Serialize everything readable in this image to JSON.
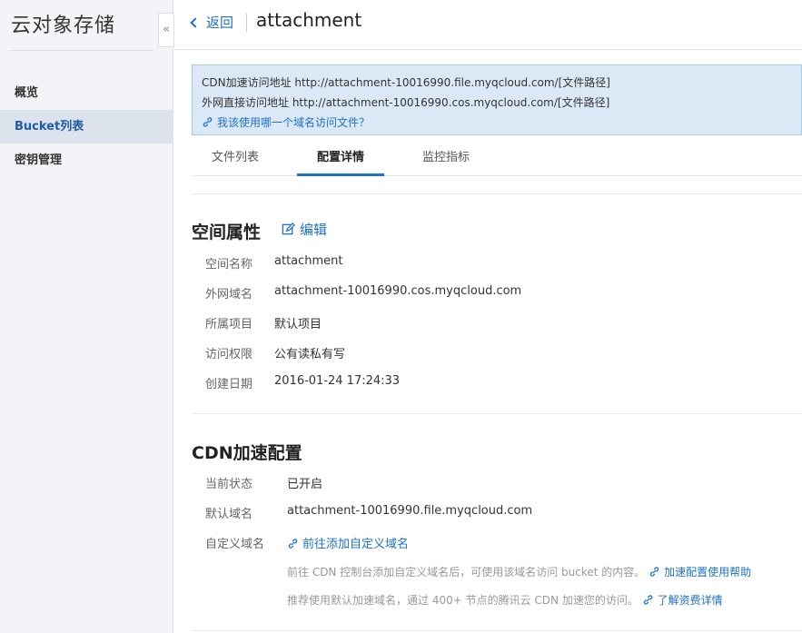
{
  "sidebar": {
    "title": "云对象存储",
    "collapse_icon": "«",
    "items": [
      {
        "label": "概览",
        "active": false
      },
      {
        "label": "Bucket列表",
        "active": true
      },
      {
        "label": "密钥管理",
        "active": false
      }
    ]
  },
  "header": {
    "back_label": "返回",
    "title": "attachment"
  },
  "notice": {
    "cdn_line": "CDN加速访问地址 http://attachment-10016990.file.myqcloud.com/[文件路径]",
    "direct_line": "外网直接访问地址 http://attachment-10016990.cos.myqcloud.com/[文件路径]",
    "help_link": "我该使用哪一个域名访问文件？"
  },
  "tabs": [
    {
      "label": "文件列表",
      "active": false
    },
    {
      "label": "配置详情",
      "active": true
    },
    {
      "label": "监控指标",
      "active": false
    }
  ],
  "space": {
    "title": "空间属性",
    "edit_label": "编辑",
    "rows": [
      {
        "label": "空间名称",
        "value": "attachment"
      },
      {
        "label": "外网域名",
        "value": "attachment-10016990.cos.myqcloud.com"
      },
      {
        "label": "所属项目",
        "value": "默认项目"
      },
      {
        "label": "访问权限",
        "value": "公有读私有写"
      },
      {
        "label": "创建日期",
        "value": "2016-01-24 17:24:33"
      }
    ]
  },
  "cdn": {
    "title": "CDN加速配置",
    "status_label": "当前状态",
    "status_value": "已开启",
    "domain_label": "默认域名",
    "domain_value": "attachment-10016990.file.myqcloud.com",
    "custom_label": "自定义域名",
    "custom_link": "前往添加自定义域名",
    "hint1_text": "前往 CDN 控制台添加自定义域名后，可使用该域名访问 bucket 的内容。",
    "hint1_link": "加速配置使用帮助",
    "hint2_text": "推荐使用默认加速域名，通过 400+ 节点的腾讯云 CDN 加速您的访问。",
    "hint2_link": "了解资费详情"
  },
  "colors": {
    "accent": "#1e71c5",
    "notice_bg": "#dbe9f7",
    "sidebar_bg": "#f2f4f7"
  }
}
